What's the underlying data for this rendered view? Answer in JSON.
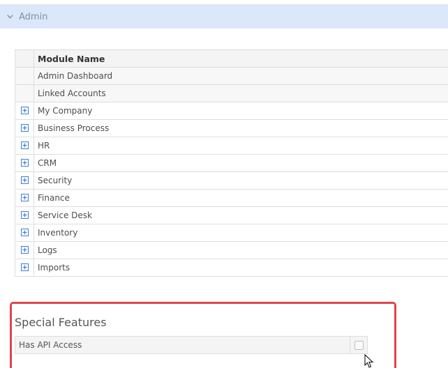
{
  "admin_section": {
    "title": "Admin",
    "expanded": true,
    "toggle_icon": "chevron-down-icon"
  },
  "modules_table": {
    "header": "Module Name",
    "rows": [
      {
        "name": "Admin Dashboard",
        "expandable": false
      },
      {
        "name": "Linked Accounts",
        "expandable": false
      },
      {
        "name": "My Company",
        "expandable": true
      },
      {
        "name": "Business Process",
        "expandable": true
      },
      {
        "name": "HR",
        "expandable": true
      },
      {
        "name": "CRM",
        "expandable": true
      },
      {
        "name": "Security",
        "expandable": true
      },
      {
        "name": "Finance",
        "expandable": true
      },
      {
        "name": "Service Desk",
        "expandable": true
      },
      {
        "name": "Inventory",
        "expandable": true
      },
      {
        "name": "Logs",
        "expandable": true
      },
      {
        "name": "Imports",
        "expandable": true
      }
    ],
    "expand_icon": "plus-box-icon"
  },
  "special_features": {
    "title": "Special Features",
    "items": [
      {
        "label": "Has API Access",
        "checked": false
      }
    ]
  },
  "colors": {
    "header_bg": "#dbe8fb",
    "header_text": "#7f8fa6",
    "plus_icon": "#3b7fd4",
    "highlight_border": "#e0444b"
  }
}
